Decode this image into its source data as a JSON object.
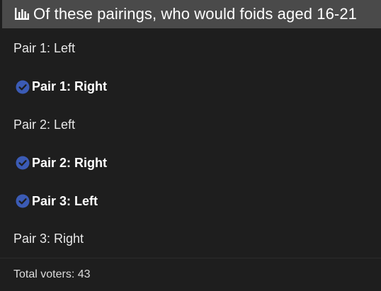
{
  "header": {
    "icon": "poll-chart-icon",
    "title": "Of these pairings, who would foids aged 16-21"
  },
  "options": [
    {
      "label": "Pair 1: Left",
      "selected": false
    },
    {
      "label": "Pair 1: Right",
      "selected": true
    },
    {
      "label": "Pair 2: Left",
      "selected": false
    },
    {
      "label": "Pair 2: Right",
      "selected": true
    },
    {
      "label": "Pair 3: Left",
      "selected": true
    },
    {
      "label": "Pair 3: Right",
      "selected": false
    }
  ],
  "footer": {
    "total_voters": "Total voters: 43"
  },
  "colors": {
    "background": "#1e1e1e",
    "header_background": "#4a4a4a",
    "check_accent": "#3b5bb5"
  }
}
